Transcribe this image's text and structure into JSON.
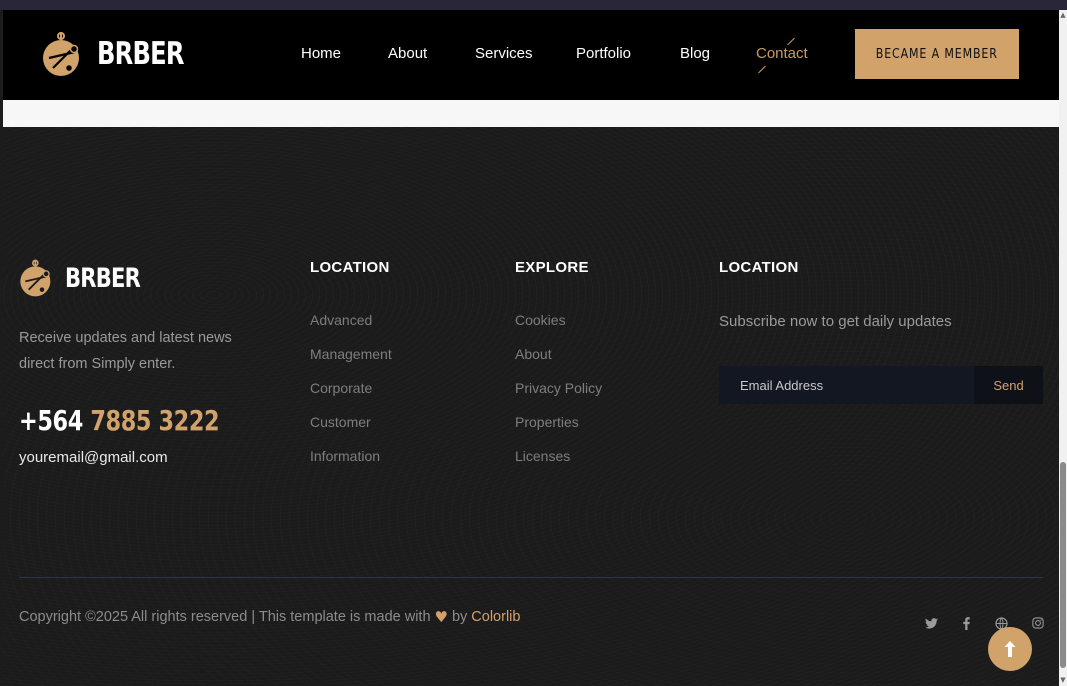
{
  "header": {
    "logo_text": "BRBER",
    "nav": [
      {
        "label": "Home"
      },
      {
        "label": "About"
      },
      {
        "label": "Services"
      },
      {
        "label": "Portfolio"
      },
      {
        "label": "Blog"
      },
      {
        "label": "Contact",
        "active": true
      }
    ],
    "cta_label": "BECAME A MEMBER"
  },
  "footer": {
    "logo_text": "BRBER",
    "description": "Receive updates and latest news direct from Simply enter.",
    "phone_prefix": "+564",
    "phone_number": "7885 3222",
    "email": "youremail@gmail.com",
    "columns": [
      {
        "title": "LOCATION",
        "links": [
          "Advanced",
          "Management",
          "Corporate",
          "Customer",
          "Information"
        ]
      },
      {
        "title": "EXPLORE",
        "links": [
          "Cookies",
          "About",
          "Privacy Policy",
          "Properties",
          "Licenses"
        ]
      }
    ],
    "subscribe": {
      "title": "LOCATION",
      "text": "Subscribe now to get daily updates",
      "placeholder": "Email Address",
      "button": "Send"
    },
    "copyright": {
      "text": "Copyright ©2025 All rights reserved | This template is made with",
      "by": "by",
      "brand": "Colorlib"
    },
    "social_icons": [
      "twitter-icon",
      "facebook-icon",
      "globe-icon",
      "instagram-icon"
    ]
  },
  "colors": {
    "accent": "#d2a26b",
    "header_bg": "#000000",
    "footer_bg": "#1b1b1b",
    "input_bg": "#131722"
  }
}
